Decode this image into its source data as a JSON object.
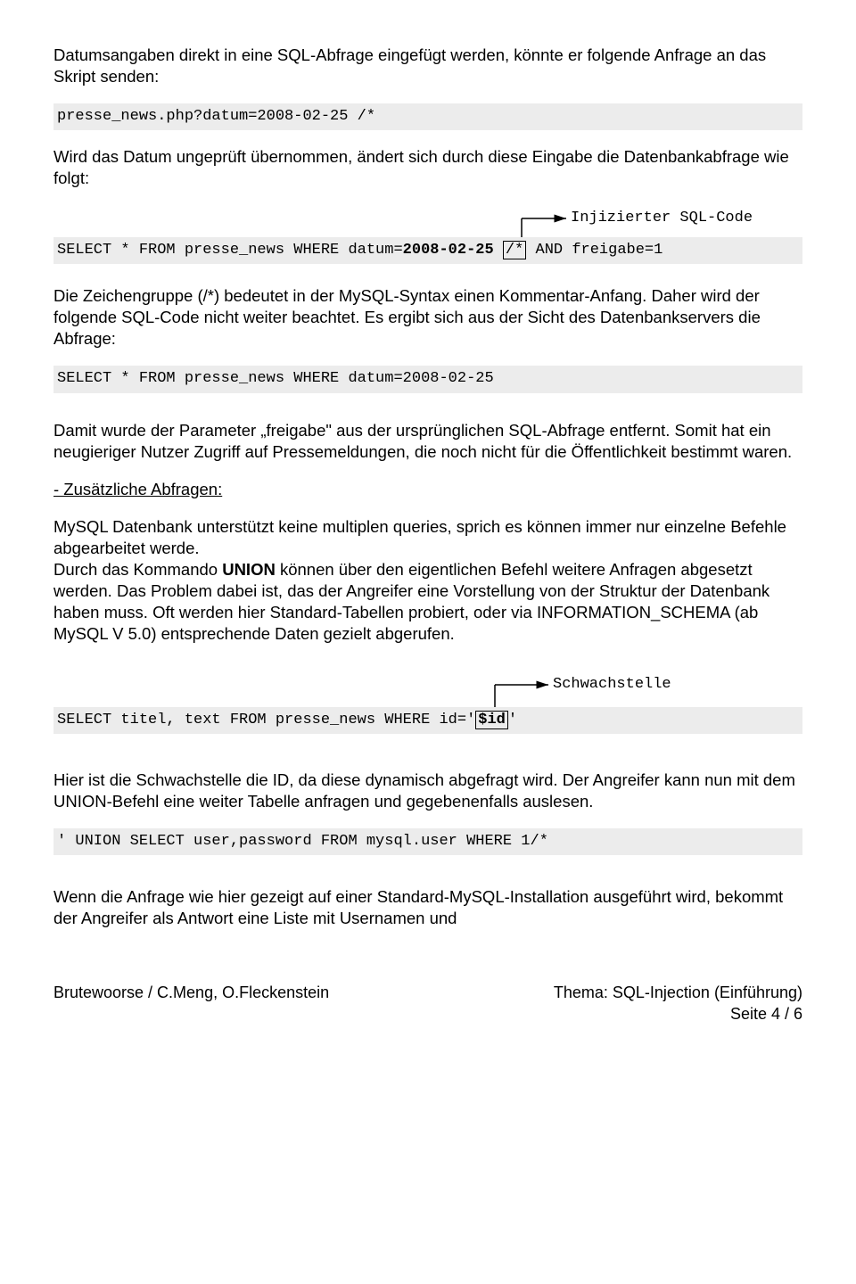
{
  "p1": "Datumsangaben direkt in eine SQL-Abfrage eingefügt werden, könnte er folgende Anfrage an das Skript senden:",
  "code1": "presse_news.php?datum=2008-02-25 /*",
  "p2": "Wird das Datum ungeprüft übernommen, ändert sich durch diese Eingabe die Datenbankabfrage wie folgt:",
  "annot1": "Injizierter SQL-Code",
  "code2a": "SELECT * FROM presse_news WHERE datum=",
  "code2b": "2008-02-25",
  "code2c": "/*",
  "code2d": " AND freigabe=1",
  "p3": "Die Zeichengruppe (/*) bedeutet in der MySQL-Syntax einen Kommentar-Anfang. Daher wird der folgende SQL-Code nicht weiter beachtet. Es ergibt sich aus der Sicht des Datenbankservers die Abfrage:",
  "code3": "SELECT * FROM presse_news WHERE datum=2008-02-25",
  "p4": "Damit wurde der Parameter „freigabe\" aus der ursprünglichen SQL-Abfrage entfernt. Somit hat ein neugieriger Nutzer Zugriff auf Pressemeldungen, die noch nicht für die Öffentlichkeit bestimmt waren.",
  "h1": "- Zusätzliche Abfragen:",
  "p5a": "MySQL Datenbank unterstützt keine multiplen queries, sprich es können immer nur einzelne Befehle abgearbeitet werde.",
  "p5b_pre": "Durch das Kommando ",
  "p5b_bold": "UNION",
  "p5b_post": " können über den eigentlichen Befehl weitere Anfragen abgesetzt werden. Das Problem dabei ist, das der Angreifer eine Vorstellung von der Struktur der Datenbank haben muss. Oft werden hier Standard-Tabellen probiert, oder via INFORMATION_SCHEMA (ab MySQL V 5.0) entsprechende Daten gezielt abgerufen.",
  "annot2": "Schwachstelle",
  "code4a": "SELECT titel, text FROM presse_news WHERE id='",
  "code4b": "$id",
  "code4c": "'",
  "p6": "Hier ist die Schwachstelle die ID, da diese dynamisch abgefragt wird. Der Angreifer kann nun mit dem UNION-Befehl eine weiter Tabelle anfragen und gegebenenfalls auslesen.",
  "code5": " ' UNION SELECT user,password FROM mysql.user WHERE 1/*",
  "p7": "Wenn die Anfrage wie hier gezeigt auf einer Standard-MySQL-Installation ausgeführt wird, bekommt der Angreifer als Antwort eine Liste mit Usernamen und",
  "footer_left": "Brutewoorse / C.Meng, O.Fleckenstein",
  "footer_right1": "Thema: SQL-Injection (Einführung)",
  "footer_right2": "Seite 4 / 6"
}
